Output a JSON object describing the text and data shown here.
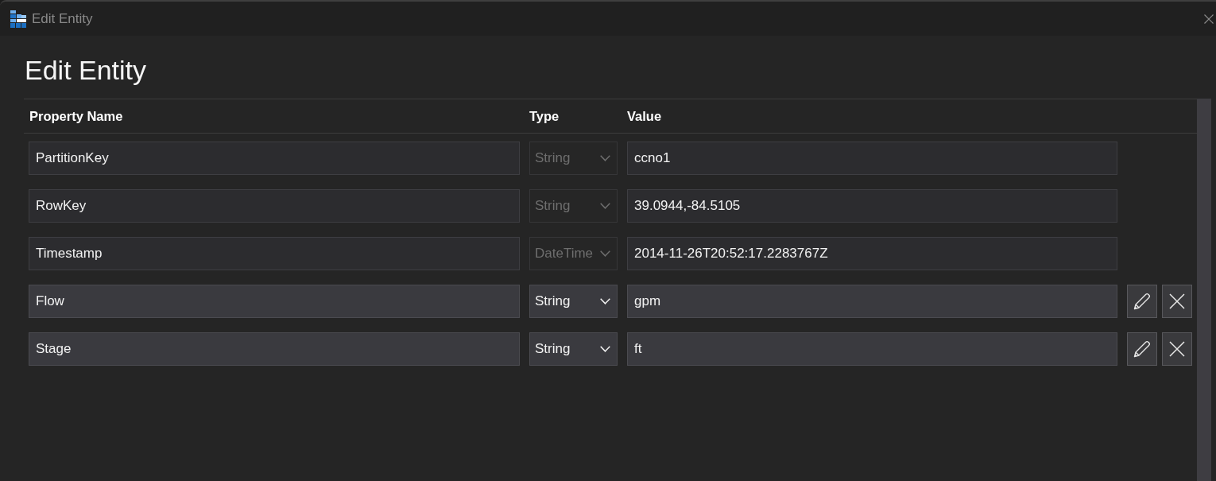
{
  "window": {
    "title": "Edit Entity"
  },
  "heading": "Edit Entity",
  "table": {
    "columns": [
      "Property Name",
      "Type",
      "Value"
    ],
    "rows": [
      {
        "name": "PartitionKey",
        "type": "String",
        "value": "ccno1",
        "disabled": true
      },
      {
        "name": "RowKey",
        "type": "String",
        "value": "39.0944,-84.5105",
        "disabled": true
      },
      {
        "name": "Timestamp",
        "type": "DateTime",
        "value": "2014-11-26T20:52:17.2283767Z",
        "disabled": true
      },
      {
        "name": "Flow",
        "type": "String",
        "value": "gpm",
        "disabled": false
      },
      {
        "name": "Stage",
        "type": "String",
        "value": "ft",
        "disabled": false
      }
    ]
  }
}
